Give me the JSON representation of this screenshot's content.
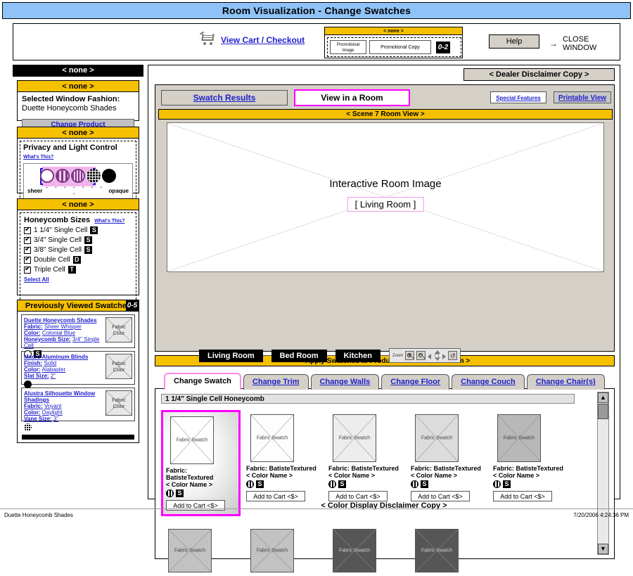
{
  "window": {
    "title": "Room Visualization -  Change Swatches"
  },
  "toolbar": {
    "cart_icon": "shopping-cart-icon",
    "cart_link": "View Cart / Checkout",
    "promo": {
      "header": "< none >",
      "image_label": "Promotional\nImage",
      "copy_label": "Promotional Copy",
      "counter": "0-2"
    },
    "help_label": "Help",
    "close_arrow": "→",
    "close_label": "CLOSE WINDOW"
  },
  "sidebar": {
    "top_header": "< none >",
    "selected_fashion": {
      "header": "< none >",
      "label": "Selected Window Fashion:",
      "value": "Duette Honeycomb Shades",
      "change_product": "Change Product"
    },
    "privacy": {
      "header": "< none >",
      "title": "Privacy and Light Control",
      "whats_this": "What's This?",
      "scale_left": "sheer",
      "scale_right": "opaque",
      "scale_dots": "·   ·   ·   ·   ·   ·   ·   ·",
      "icons": [
        "sheer-circle-icon",
        "semi-sheer-circle-icon",
        "semi-opaque-circle-icon",
        "grid-circle-icon",
        "opaque-circle-icon"
      ]
    },
    "honeycomb": {
      "header": "< none >",
      "title": "Honeycomb Sizes",
      "whats_this": "What's This?",
      "options": [
        {
          "label": "1 1/4\"  Single Cell",
          "code": "S",
          "checked": true
        },
        {
          "label": "3/4\"  Single Cell",
          "code": "S",
          "checked": true
        },
        {
          "label": "3/8\"  Single Cell",
          "code": "S",
          "checked": true
        },
        {
          "label": "Double Cell",
          "code": "D",
          "checked": true
        },
        {
          "label": "Triple Cell",
          "code": "T",
          "checked": true
        }
      ],
      "select_all": "Select All"
    },
    "previously_viewed": {
      "header": "Previously Viewed Swatches",
      "count": "0-5",
      "items": [
        {
          "title": "Duette Honeycomb Shades",
          "lines": [
            {
              "key": "Fabric:",
              "value": "Sheer Whisper"
            },
            {
              "key": "Color:",
              "value": "Colonial Blue"
            },
            {
              "key": "Honeycomb Size:",
              "value": "3/4\" Single Cell"
            }
          ],
          "icons": [
            "open-circle-icon"
          ],
          "code": "S",
          "thumb": "Fabric Color"
        },
        {
          "title": "Macro Aluminum Blinds",
          "lines": [
            {
              "key": "Finish:",
              "value": "Solid"
            },
            {
              "key": "Color:",
              "value": "Alabaster"
            },
            {
              "key": "Slat Size:",
              "value": "2\""
            }
          ],
          "icons": [
            "solid-circle-icon"
          ],
          "code": "",
          "thumb": "Fabric Color"
        },
        {
          "title": "Alustra Silhouette Window Shadings",
          "lines": [
            {
              "key": "Fabric:",
              "value": "Voyant"
            },
            {
              "key": "Color:",
              "value": "Daylight"
            },
            {
              "key": "Vane Size:",
              "value": "3\""
            }
          ],
          "icons": [
            "grid-circle-icon"
          ],
          "code": "",
          "thumb": "Fabric Color"
        }
      ]
    }
  },
  "main": {
    "dealer_disclaimer": "< Dealer Disclaimer Copy >",
    "swatch_results_tab": "Swatch Results",
    "view_in_room_tab": "View in a Room",
    "special_features": "Special Features",
    "printable_view": "Printable View",
    "scene_header": "< Scene 7 Room View >",
    "room_image_label": "Interactive Room Image",
    "room_tag": "[ Living Room ]",
    "room_buttons": [
      "Living Room",
      "Bed Room",
      "Kitchen"
    ],
    "zoom_control": {
      "label": "Zoom",
      "buttons": [
        "zoom-in-icon",
        "zoom-out-icon",
        "pan-dpad-icon",
        "reset-icon"
      ]
    },
    "apply_header": "< Apply Swatches to Product in Window of Room >",
    "tabs": [
      {
        "label": "Change Swatch",
        "active": true
      },
      {
        "label": "Change Trim",
        "active": false
      },
      {
        "label": "Change Walls",
        "active": false
      },
      {
        "label": "Change Floor",
        "active": false
      },
      {
        "label": "Change Couch",
        "active": false
      },
      {
        "label": "Change Chair(s)",
        "active": false
      }
    ],
    "size_bar": "1 1/4\" Single Cell Honeycomb",
    "swatch_caption": "Fabric Swatch",
    "swatches_row1": [
      {
        "fabric": "Fabric: BatisteTextured",
        "color": "< Color Name >",
        "code": "S",
        "add": "Add to Cart <$>",
        "selected": true,
        "bg": "#ffffff"
      },
      {
        "fabric": "Fabric: BatisteTextured",
        "color": "< Color Name >",
        "code": "S",
        "add": "Add to Cart <$>",
        "selected": false,
        "bg": "#fdfdfd"
      },
      {
        "fabric": "Fabric: BatisteTextured",
        "color": "< Color Name >",
        "code": "S",
        "add": "Add to Cart <$>",
        "selected": false,
        "bg": "#ededed"
      },
      {
        "fabric": "Fabric: BatisteTextured",
        "color": "< Color Name >",
        "code": "S",
        "add": "Add to Cart <$>",
        "selected": false,
        "bg": "#dcdcdc"
      },
      {
        "fabric": "Fabric: BatisteTextured",
        "color": "< Color Name >",
        "code": "S",
        "add": "Add to Cart <$>",
        "selected": false,
        "bg": "#b8b8b8"
      }
    ],
    "swatches_row2": [
      {
        "bg": "#c2c2c2"
      },
      {
        "bg": "#c2c2c2"
      },
      {
        "bg": "#565656"
      },
      {
        "bg": "#565656"
      }
    ],
    "scrollbar": {
      "up": "▲",
      "down": "▼"
    },
    "color_disclaimer": "< Color Display Disclaimer Copy >"
  },
  "status": {
    "left": "Duette Honeycomb Shades",
    "right": "7/20/2006 4:24:36 PM"
  },
  "colors": {
    "title_bar": "#8fc3f7",
    "gold": "#f5c000",
    "magenta": "#ff00ff",
    "link": "#2020cc"
  }
}
